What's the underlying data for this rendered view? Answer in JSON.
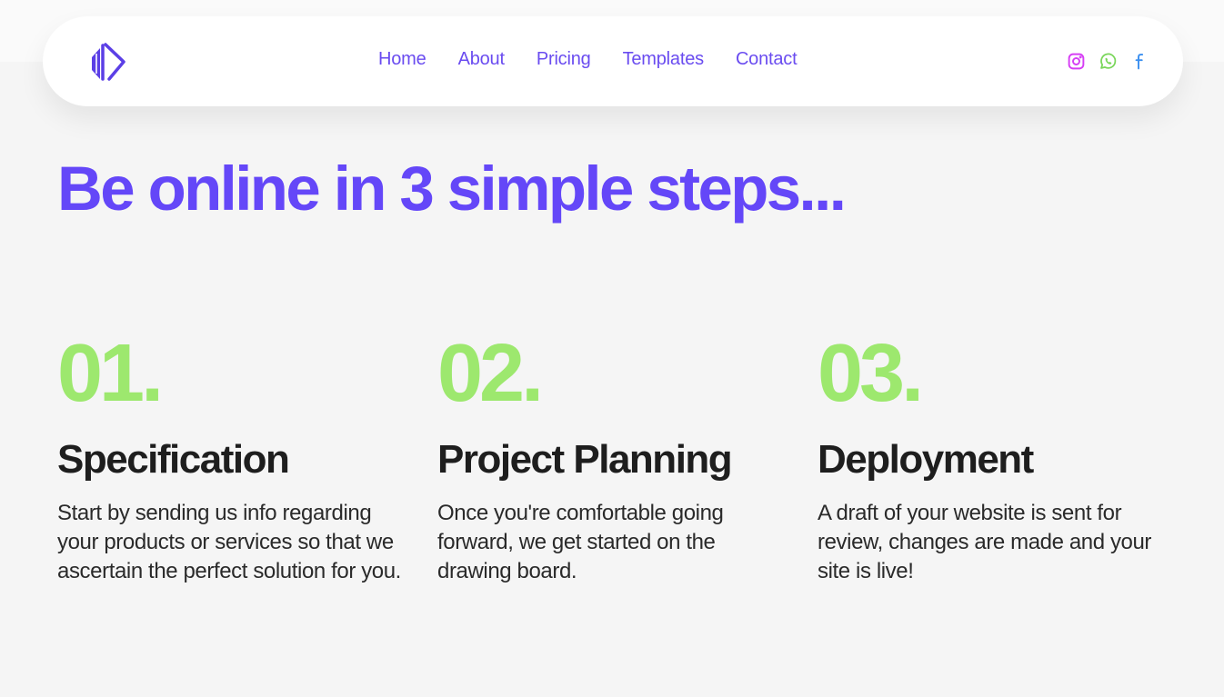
{
  "nav": {
    "logo_icon": "logo-mark-icon",
    "links": [
      {
        "label": "Home"
      },
      {
        "label": "About"
      },
      {
        "label": "Pricing"
      },
      {
        "label": "Templates"
      },
      {
        "label": "Contact"
      }
    ],
    "socials": [
      {
        "icon": "instagram-icon",
        "color": "#d63ef5"
      },
      {
        "icon": "whatsapp-icon",
        "color": "#7ad65a"
      },
      {
        "icon": "facebook-icon",
        "color": "#3b8ff0"
      }
    ]
  },
  "hero": {
    "title": "Be online in 3 simple steps..."
  },
  "steps": [
    {
      "number": "01.",
      "title": "Specification",
      "text": "Start by sending us info regarding your products or services so that we ascertain the perfect solution for you."
    },
    {
      "number": "02.",
      "title": "Project Planning",
      "text": "Once you're comfortable going forward, we get started on the drawing board."
    },
    {
      "number": "03.",
      "title": "Deployment",
      "text": "A draft of your website is sent for review, changes are made and your site is live!"
    }
  ],
  "colors": {
    "brand_purple": "#6447f8",
    "accent_green": "#9de86e",
    "text_dark": "#1e1e1e",
    "background": "#f5f5f5"
  }
}
